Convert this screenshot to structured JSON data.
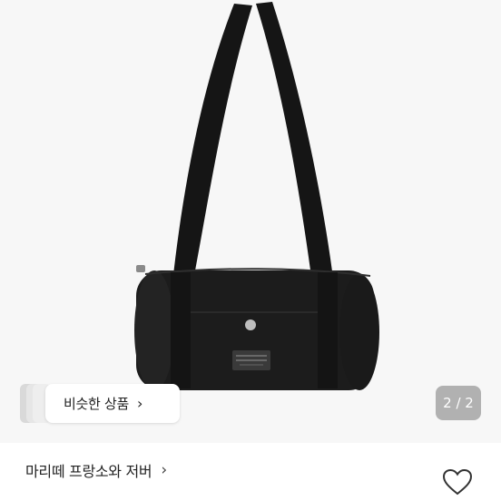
{
  "product_image": {
    "alt": "black barrel shoulder bag"
  },
  "similar_products": {
    "label": "비슷한 상품",
    "chevron": "›"
  },
  "pager": {
    "text": "2 / 2"
  },
  "store": {
    "name": "마리떼 프랑소와 저버",
    "chevron": "›"
  },
  "icons": {
    "heart": "heart-outline-icon",
    "chevron": "chevron-right-icon"
  },
  "colors": {
    "bag": "#1c1c1c",
    "badge_bg": "rgba(120,120,120,0.55)"
  }
}
